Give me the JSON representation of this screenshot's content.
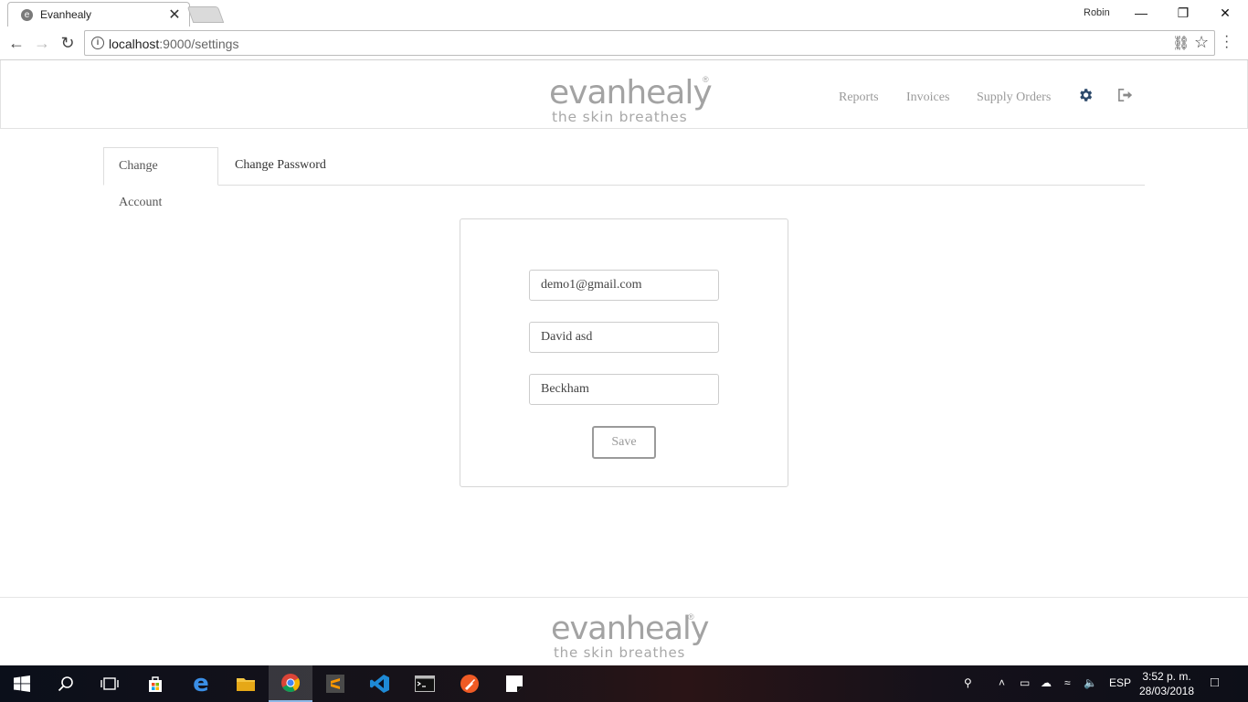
{
  "browser": {
    "tab_title": "Evanhealy",
    "tab_favicon": "e",
    "profile_name": "Robin",
    "url_host": "localhost",
    "url_rest": ":9000/settings"
  },
  "header": {
    "logo_brand": "evanhealy",
    "logo_tagline": "the skin breathes",
    "logo_mark": "®",
    "nav": {
      "reports": "Reports",
      "invoices": "Invoices",
      "supply_orders": "Supply Orders"
    }
  },
  "settings": {
    "tabs": {
      "change_account": "Change Account",
      "change_password": "Change Password"
    },
    "form": {
      "email": "demo1@gmail.com",
      "first_name": "David asd",
      "last_name": "Beckham",
      "save_label": "Save"
    }
  },
  "footer": {
    "logo_brand": "evanhealy",
    "logo_tagline": "the skin breathes",
    "logo_mark": "®"
  },
  "taskbar": {
    "language": "ESP",
    "time": "3:52 p. m.",
    "date": "28/03/2018"
  },
  "colors": {
    "accent_icon": "#2e4a6b",
    "nav_text": "#9a9a9a",
    "logo_grey": "#a3a3a3"
  }
}
